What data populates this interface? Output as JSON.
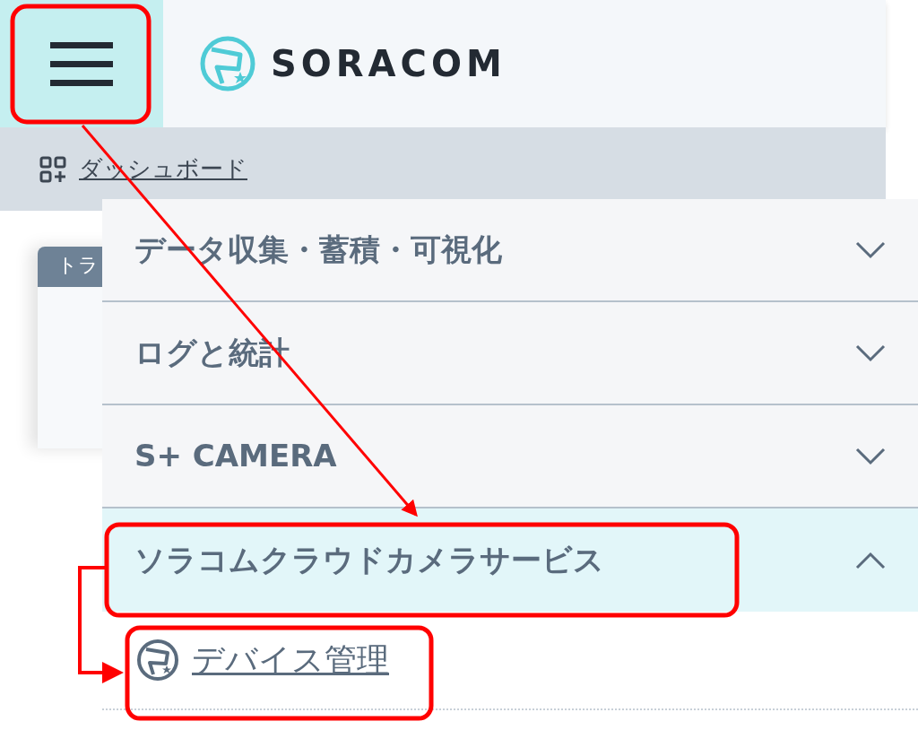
{
  "header": {
    "logo_text": "SORACOM"
  },
  "nav": {
    "dashboard": "ダッシュボード"
  },
  "card": {
    "tab_label": "トラ"
  },
  "menu": {
    "sections": [
      {
        "label": "データ収集・蓄積・可視化",
        "expanded": false
      },
      {
        "label": "ログと統計",
        "expanded": false
      },
      {
        "label": "S+ CAMERA",
        "expanded": false
      },
      {
        "label": "ソラコムクラウドカメラサービス",
        "expanded": true,
        "children": [
          {
            "label": "デバイス管理"
          }
        ]
      }
    ]
  }
}
